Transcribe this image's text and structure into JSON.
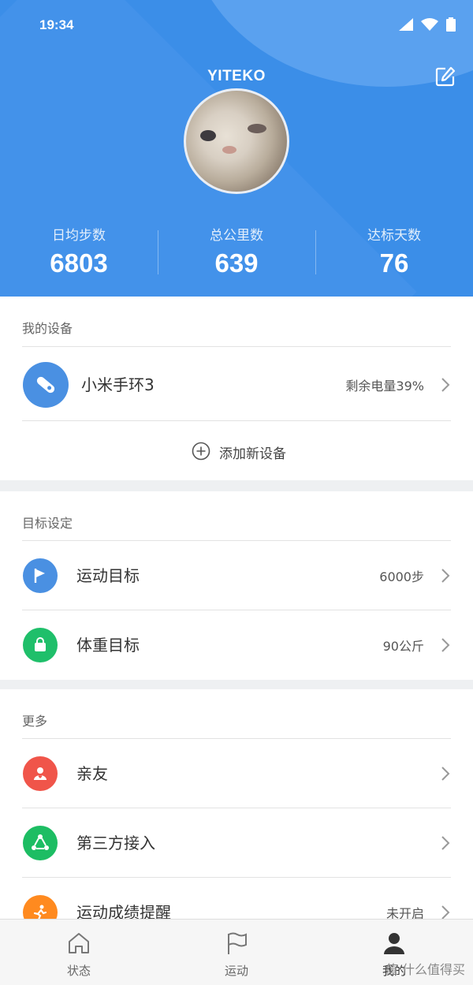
{
  "status_bar": {
    "time": "19:34"
  },
  "profile": {
    "name": "YITEKO"
  },
  "stats": [
    {
      "label": "日均步数",
      "value": "6803"
    },
    {
      "label": "总公里数",
      "value": "639"
    },
    {
      "label": "达标天数",
      "value": "76"
    }
  ],
  "devices": {
    "title": "我的设备",
    "items": [
      {
        "label": "小米手环3",
        "value": "剩余电量39%"
      }
    ],
    "add_label": "添加新设备"
  },
  "goals": {
    "title": "目标设定",
    "items": [
      {
        "label": "运动目标",
        "value": "6000步"
      },
      {
        "label": "体重目标",
        "value": "90公斤"
      }
    ]
  },
  "more": {
    "title": "更多",
    "items": [
      {
        "label": "亲友",
        "value": ""
      },
      {
        "label": "第三方接入",
        "value": ""
      },
      {
        "label": "运动成绩提醒",
        "value": "未开启"
      }
    ]
  },
  "nav": [
    {
      "label": "状态",
      "icon": "home-icon"
    },
    {
      "label": "运动",
      "icon": "flag-icon"
    },
    {
      "label": "我的",
      "icon": "person-icon"
    }
  ],
  "watermark": "值 什么值得买",
  "colors": {
    "header_blue": "#3b8ee8",
    "device_blue": "#4a90e2",
    "goal_green": "#1fbf6a",
    "friend_red": "#f0554a",
    "third_party_green": "#1dbd63",
    "reminder_orange": "#ff8a1f"
  }
}
